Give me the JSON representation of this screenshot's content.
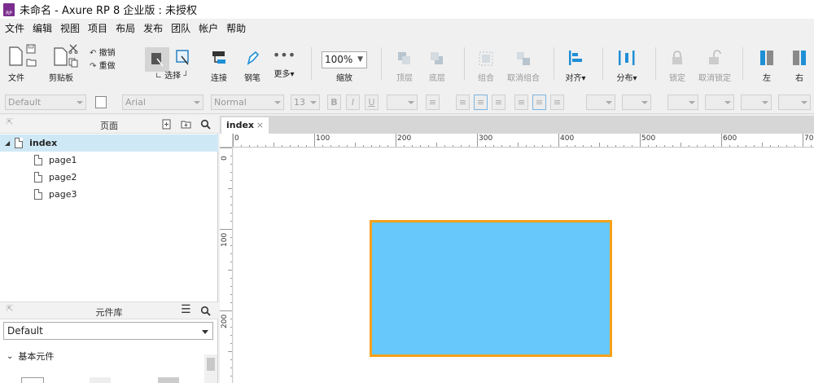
{
  "window": {
    "title": "未命名 - Axure RP 8 企业版 : 未授权",
    "app_icon": "axure-rp-icon"
  },
  "menu": [
    "文件",
    "编辑",
    "视图",
    "项目",
    "布局",
    "发布",
    "团队",
    "帐户",
    "帮助"
  ],
  "toolbar": {
    "file_label": "文件",
    "clipboard_label": "剪贴板",
    "undo_label": "撤销",
    "redo_label": "重做",
    "select_label": "选择",
    "connect_label": "连接",
    "pen_label": "钢笔",
    "more_label": "更多",
    "zoom_value": "100%",
    "zoom_label": "缩放",
    "top_label": "顶层",
    "bottom_label": "底层",
    "group_label": "组合",
    "ungroup_label": "取消组合",
    "align_label": "对齐",
    "distribute_label": "分布",
    "lock_label": "锁定",
    "unlock_label": "取消锁定",
    "left_label": "左",
    "right_label": "右"
  },
  "format": {
    "style_value": "Default",
    "font_value": "Arial",
    "weight_value": "Normal",
    "size_value": "13",
    "bold": "B",
    "italic": "I",
    "underline": "U"
  },
  "pages_panel": {
    "title": "页面",
    "items": [
      {
        "label": "index"
      },
      {
        "label": "page1"
      },
      {
        "label": "page2"
      },
      {
        "label": "page3"
      }
    ]
  },
  "library_panel": {
    "title": "元件库",
    "selected_library": "Default",
    "category": "基本元件"
  },
  "editor": {
    "tab_label": "index",
    "close_glyph": "×",
    "ruler_h": [
      "0",
      "100",
      "200",
      "300",
      "400",
      "500",
      "600",
      "70"
    ],
    "ruler_v": [
      "0",
      "100",
      "200"
    ]
  },
  "colors": {
    "accent": "#1f8fd6",
    "selection_bg": "#cfe8f6",
    "widget_fill": "#67c8fb",
    "widget_border": "#f5a11b"
  }
}
